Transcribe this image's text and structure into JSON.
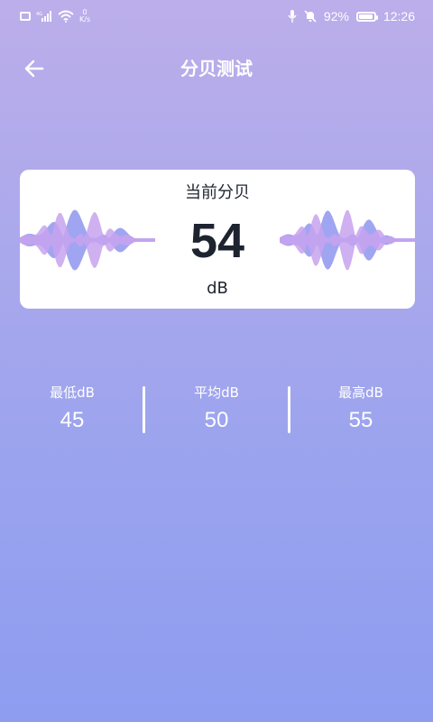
{
  "status_bar": {
    "network_speed": "0\nK/s",
    "battery_percent": "92%",
    "battery_level": 0.92,
    "time": "12:26",
    "icons": [
      "screen-record-icon",
      "signal-icon",
      "wifi-icon",
      "network-speed",
      "mic-icon",
      "mute-bell-icon",
      "battery-icon"
    ]
  },
  "header": {
    "back_icon": "arrow-left-icon",
    "title": "分贝测试"
  },
  "card": {
    "label": "当前分贝",
    "current_db": "54",
    "unit": "dB",
    "wave_color_primary": "#8f95ef",
    "wave_color_secondary": "#c7a2ee"
  },
  "stats": {
    "min": {
      "label": "最低dB",
      "value": "45"
    },
    "avg": {
      "label": "平均dB",
      "value": "50"
    },
    "max": {
      "label": "最高dB",
      "value": "55"
    }
  }
}
